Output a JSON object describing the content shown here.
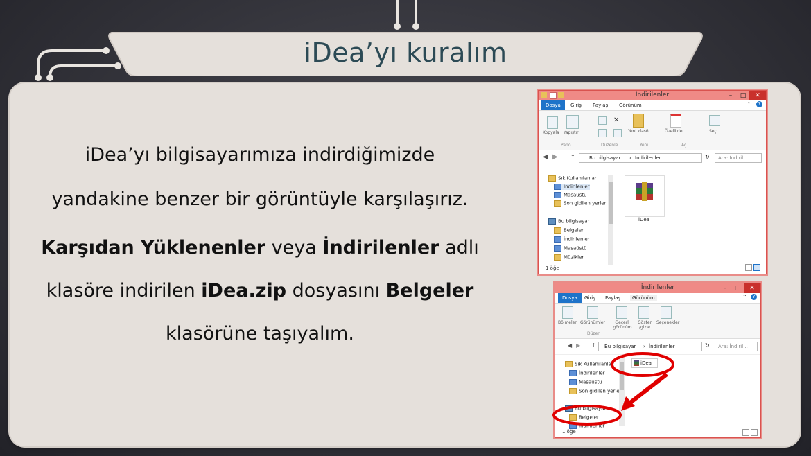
{
  "slide": {
    "title": "iDea’yı kuralım",
    "p1_line1": "iDea’yı bilgisayarımıza indirdiğimizde",
    "p1_line2": "yandakine benzer bir görüntüyle karşılaşırız.",
    "p2_bold1": "Karşıdan Yüklenenler",
    "p2_t1": " veya ",
    "p2_bold2": "İndirilenler",
    "p2_t2": " adlı",
    "p3_t1": "klasöre indirilen ",
    "p3_bold1": "iDea.zip",
    "p3_t2": " dosyasını ",
    "p3_bold2": "Belgeler",
    "p4": "klasörüne taşıyalım."
  },
  "colors": {
    "title": "#2c4a55",
    "panel": "#e5e0db",
    "window_frame": "#ef8a86",
    "file_tab": "#1e73c9",
    "highlight_circle": "#e00000"
  },
  "window1": {
    "title": "İndirilenler",
    "tabs": {
      "file": "Dosya",
      "home": "Giriş",
      "share": "Paylaş",
      "view": "Görünüm"
    },
    "ribbon": {
      "copy": "Kopyala",
      "paste": "Yapıştır",
      "clipboard_group": "Pano",
      "organize_group": "Düzenle",
      "new_folder": "Yeni klasör",
      "new_group": "Yeni",
      "properties": "Özellikler",
      "open_group": "Aç",
      "select": "Seç"
    },
    "address": {
      "pc": "Bu bilgisayar",
      "folder": "İndirilenler",
      "search": "Ara: İndiril..."
    },
    "nav": {
      "favorites": "Sık Kullanılanlar",
      "downloads": "İndirilenler",
      "desktop": "Masaüstü",
      "recent": "Son gidilen yerler",
      "this_pc": "Bu bilgisayar",
      "documents": "Belgeler",
      "downloads2": "İndirilenler",
      "desktop2": "Masaüstü",
      "music": "Müzikler"
    },
    "file_name": "iDea",
    "status": "1 öğe"
  },
  "window2": {
    "title": "İndirilenler",
    "tabs": {
      "file": "Dosya",
      "home": "Giriş",
      "share": "Paylaş",
      "view": "Görünüm"
    },
    "ribbon": {
      "panes": "Bölmeler",
      "layout": "Görünümler",
      "layout_group": "Düzen",
      "current_view": "Geçerli görünüm",
      "show_hide": "Göster /gizle",
      "options": "Seçenekler"
    },
    "address": {
      "pc": "Bu bilgisayar",
      "folder": "İndirilenler",
      "search": "Ara: İndiril..."
    },
    "nav": {
      "favorites": "Sık Kullanılanlar",
      "downloads": "İndirilenler",
      "desktop": "Masaüstü",
      "recent": "Son gidilen yerler",
      "this_pc": "Bu bilgisayar",
      "documents": "Belgeler",
      "downloads2": "İndirilenler"
    },
    "file_name": "iDea",
    "status": "1 öğe"
  }
}
